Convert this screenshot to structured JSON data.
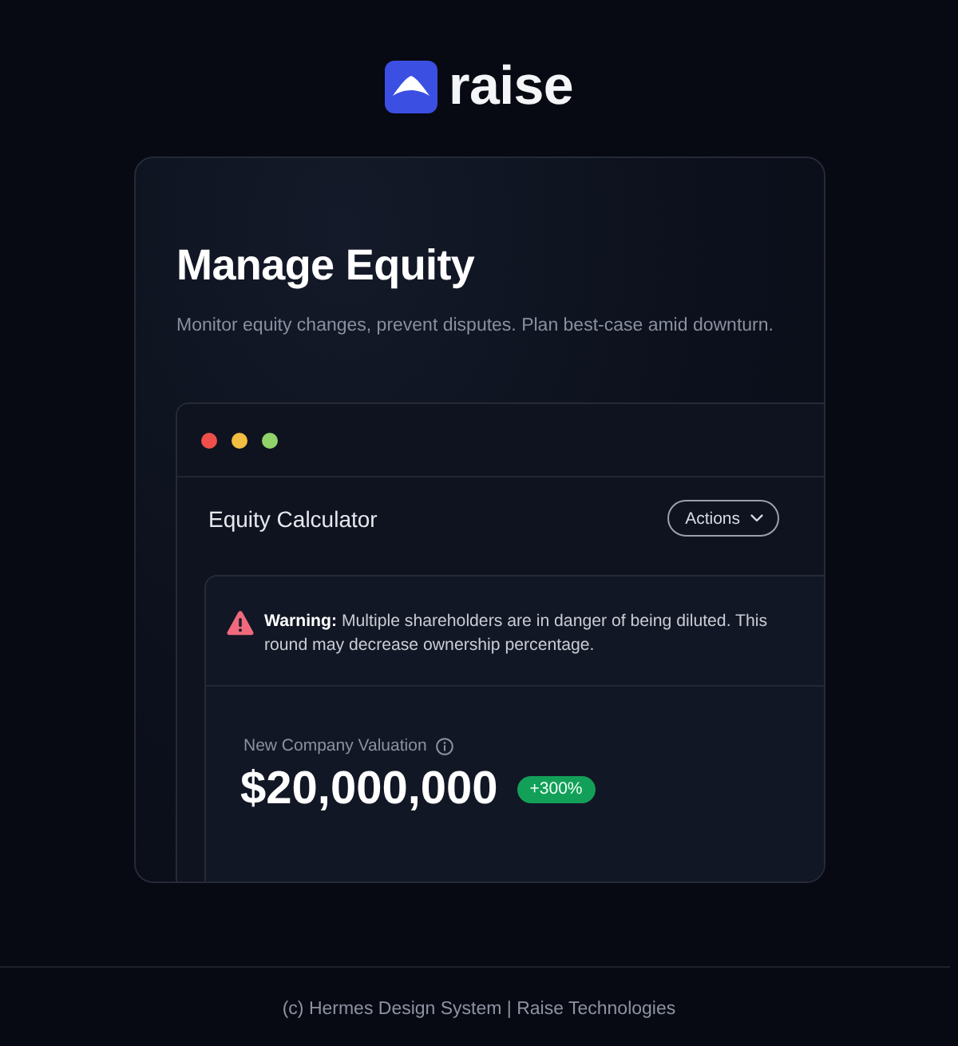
{
  "brand": {
    "name": "raise"
  },
  "card": {
    "title": "Manage Equity",
    "subtitle": "Monitor equity changes, prevent disputes. Plan best-case amid downturn."
  },
  "window": {
    "controls": [
      {
        "color": "#ee4f4b"
      },
      {
        "color": "#f2be42"
      },
      {
        "color": "#8fd36a"
      }
    ],
    "title": "Equity Calculator",
    "actions_button": "Actions"
  },
  "warning": {
    "text": "**Warning:** Multiple shareholders are in danger of being diluted. This round may decrease ownership percentage."
  },
  "valuation": {
    "label": "New Company Valuation",
    "value": "$20,000,000",
    "change": "+300%"
  },
  "footer": {
    "text": "(c) Hermes Design System | Raise Technologies"
  }
}
